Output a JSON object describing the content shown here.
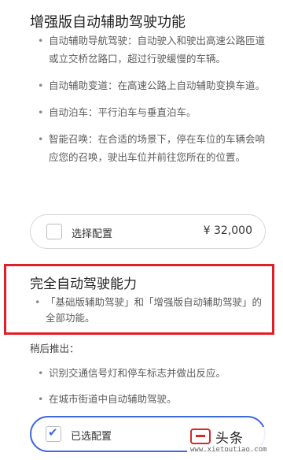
{
  "enhanced_autopilot": {
    "title": "增强版自动辅助驾驶功能",
    "features": [
      "自动辅助导航驾驶：自动驶入和驶出高速公路匝道或立交桥岔路口，超过行驶缓慢的车辆。",
      "自动辅助变道：在高速公路上自动辅助变换车道。",
      "自动泊车：平行泊车与垂直泊车。",
      "智能召唤：在合适的场景下，停在车位的车辆会响应您的召唤，驶出车位并前往您所在的位置。"
    ],
    "option": {
      "label": "选择配置",
      "price": "¥ 32,000",
      "checked": false
    }
  },
  "fsd": {
    "title": "完全自动驾驶能力",
    "features": [
      "「基础版辅助驾驶」和「增强版自动辅助驾驶」的全部功能。"
    ],
    "later_label": "稍后推出：",
    "later_features": [
      "识别交通信号灯和停车标志并做出反应。",
      "在城市街道中自动辅助驾驶。"
    ],
    "option": {
      "label": "已选配置",
      "checked": true
    }
  },
  "watermark": {
    "name": "头条",
    "url": "www.xietoutiao.com"
  },
  "colors": {
    "highlight": "#e11d25",
    "accent": "#3e6ae1"
  }
}
